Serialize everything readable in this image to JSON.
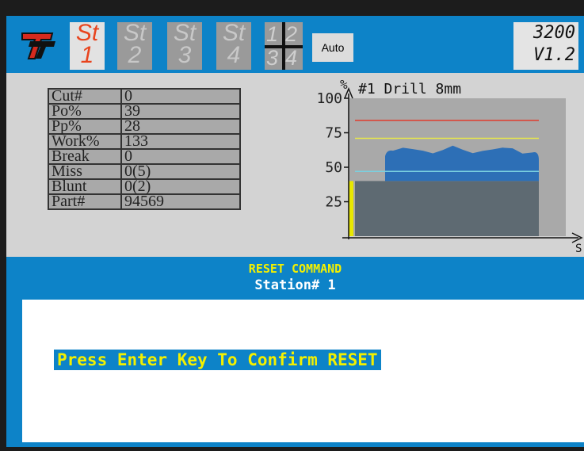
{
  "toolbar": {
    "logo": "TT",
    "stations": [
      {
        "prefix": "St",
        "num": "1",
        "active": true
      },
      {
        "prefix": "St",
        "num": "2",
        "active": false
      },
      {
        "prefix": "St",
        "num": "3",
        "active": false
      },
      {
        "prefix": "St",
        "num": "4",
        "active": false
      }
    ],
    "quad": [
      "1",
      "2",
      "3",
      "4"
    ],
    "auto_label": "Auto",
    "model": "3200",
    "version": "V1.2"
  },
  "stats": [
    {
      "label": "Cut#",
      "value": "0"
    },
    {
      "label": "Po%",
      "value": "39"
    },
    {
      "label": "Pp%",
      "value": "28"
    },
    {
      "label": "Work%",
      "value": "133"
    },
    {
      "label": "Break",
      "value": "0"
    },
    {
      "label": "Miss",
      "value": "0(5)"
    },
    {
      "label": "Blunt",
      "value": "0(2)"
    },
    {
      "label": "Part#",
      "value": "94569"
    }
  ],
  "chart_data": {
    "type": "area",
    "title": "#1 Drill 8mm",
    "ylabel": "%",
    "xlabel": "S",
    "ylim": [
      0,
      100
    ],
    "yticks": [
      "100",
      "75",
      "50",
      "25"
    ],
    "reference_lines": [
      {
        "value": 84,
        "color": "#e03c2e"
      },
      {
        "value": 71,
        "color": "#e8e84a"
      },
      {
        "value": 47,
        "color": "#7ad0e0"
      }
    ],
    "colors": {
      "area": "#2d6fb6",
      "base": "#5e6a72",
      "indicator": "#e8e800",
      "bg": "#a9a9a9"
    }
  },
  "command": {
    "title": "RESET COMMAND",
    "station": "Station# 1",
    "prompt": "Press Enter Key To Confirm RESET"
  }
}
